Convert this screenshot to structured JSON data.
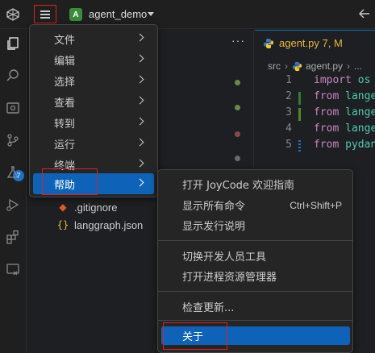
{
  "titlebar": {
    "project_badge": "A",
    "project_name": "agent_demo"
  },
  "activity": {
    "scm_badge": "7"
  },
  "explorer": {
    "more_label": "···",
    "files": [
      {
        "icon": "git-icon",
        "name": ".gitignore"
      },
      {
        "icon": "json-icon",
        "name": "langgraph.json"
      }
    ]
  },
  "editor": {
    "tab_label": "agent.py 7, M",
    "breadcrumb": [
      "src",
      "agent.py",
      "..."
    ],
    "lines": [
      {
        "num": "1",
        "keyword": "import",
        "rest": " os"
      },
      {
        "num": "2",
        "keyword": "from",
        "rest": " lange"
      },
      {
        "num": "3",
        "keyword": "from",
        "rest": " lange"
      },
      {
        "num": "4",
        "keyword": "from",
        "rest": " lange"
      },
      {
        "num": "5",
        "keyword": "from",
        "rest": " pydan"
      }
    ]
  },
  "main_menu": {
    "items": [
      {
        "label": "文件"
      },
      {
        "label": "编辑"
      },
      {
        "label": "选择"
      },
      {
        "label": "查看"
      },
      {
        "label": "转到"
      },
      {
        "label": "运行"
      },
      {
        "label": "终端"
      },
      {
        "label": "帮助",
        "active": true
      }
    ]
  },
  "help_menu": {
    "items": [
      {
        "label": "打开 JoyCode 欢迎指南",
        "shortcut": ""
      },
      {
        "label": "显示所有命令",
        "shortcut": "Ctrl+Shift+P"
      },
      {
        "label": "显示发行说明",
        "shortcut": ""
      },
      {
        "label": "切换开发人员工具",
        "shortcut": ""
      },
      {
        "label": "打开进程资源管理器",
        "shortcut": ""
      },
      {
        "label": "检查更新...",
        "shortcut": ""
      },
      {
        "label": "关于",
        "shortcut": "",
        "active": true
      }
    ]
  },
  "colors": {
    "accent": "#0e63b8",
    "highlight_outline": "#e02020",
    "modified_tab": "#e2b93d",
    "keyword": "#c586c0"
  }
}
